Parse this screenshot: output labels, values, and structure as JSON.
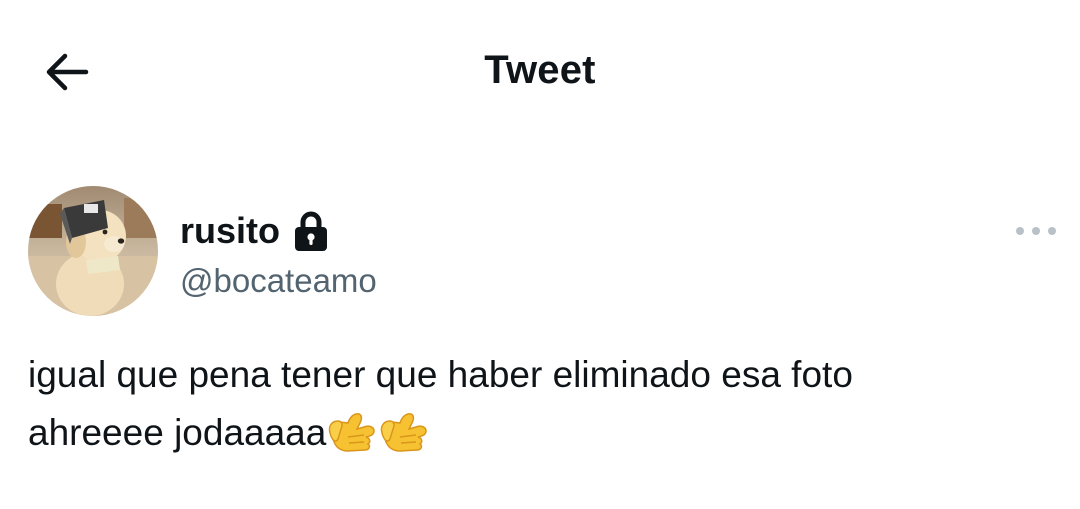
{
  "header": {
    "title": "Tweet",
    "back_icon": "arrow-left-icon"
  },
  "author": {
    "display_name": "rusito",
    "handle": "@bocateamo",
    "protected_icon": "lock-icon",
    "avatar": "dog-avatar",
    "more_icon": "more-horizontal-icon"
  },
  "tweet": {
    "text_line1": "igual que pena tener que haber eliminado esa foto",
    "text_line2": "ahreeee jodaaaaa",
    "emojis": [
      "🤙",
      "🤙"
    ]
  },
  "colors": {
    "text_primary": "#0f1419",
    "text_secondary": "#536471",
    "more_icon": "#b9c1c8",
    "emoji_yellow": "#f7c232"
  }
}
